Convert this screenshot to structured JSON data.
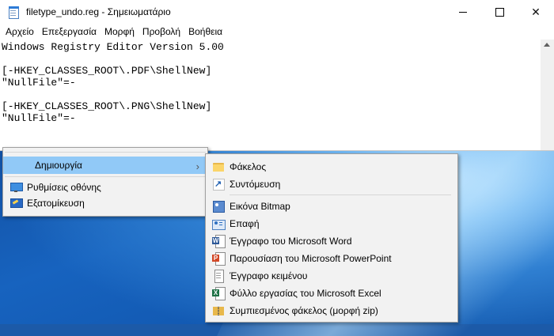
{
  "window": {
    "title": "filetype_undo.reg - Σημειωματάριο",
    "controls": {
      "minimize": "—",
      "maximize": "□",
      "close": "✕"
    }
  },
  "menubar": [
    "Αρχείο",
    "Επεξεργασία",
    "Μορφή",
    "Προβολή",
    "Βοήθεια"
  ],
  "editor": {
    "lines": [
      "Windows Registry Editor Version 5.00",
      "",
      "[-HKEY_CLASSES_ROOT\\.PDF\\ShellNew]",
      "\"NullFile\"=-",
      "",
      "[-HKEY_CLASSES_ROOT\\.PNG\\ShellNew]",
      "\"NullFile\"=-"
    ]
  },
  "context_menu": {
    "items": [
      {
        "label": "Δημιουργία",
        "icon": "none",
        "submenu": true,
        "highlighted": true
      },
      {
        "label": "Ρυθμίσεις οθόνης",
        "icon": "display-icon"
      },
      {
        "label": "Εξατομίκευση",
        "icon": "personalize-icon"
      }
    ]
  },
  "submenu": {
    "items": [
      {
        "label": "Φάκελος",
        "icon": "folder-icon"
      },
      {
        "label": "Συντόμευση",
        "icon": "shortcut-icon"
      },
      {
        "label": "Εικόνα Bitmap",
        "icon": "bitmap-icon"
      },
      {
        "label": "Επαφή",
        "icon": "contact-icon"
      },
      {
        "label": "Έγγραφο του Microsoft Word",
        "icon": "word-icon"
      },
      {
        "label": "Παρουσίαση του Microsoft PowerPoint",
        "icon": "powerpoint-icon"
      },
      {
        "label": "Έγγραφο κειμένου",
        "icon": "text-document-icon"
      },
      {
        "label": "Φύλλο εργασίας του Microsoft Excel",
        "icon": "excel-icon"
      },
      {
        "label": "Συμπιεσμένος φάκελος (μορφή zip)",
        "icon": "zip-folder-icon"
      }
    ]
  },
  "colors": {
    "highlight": "#91c9f7",
    "menu_bg": "#f2f2f2",
    "word": "#2b5797",
    "powerpoint": "#d24726",
    "excel": "#1e7145"
  }
}
